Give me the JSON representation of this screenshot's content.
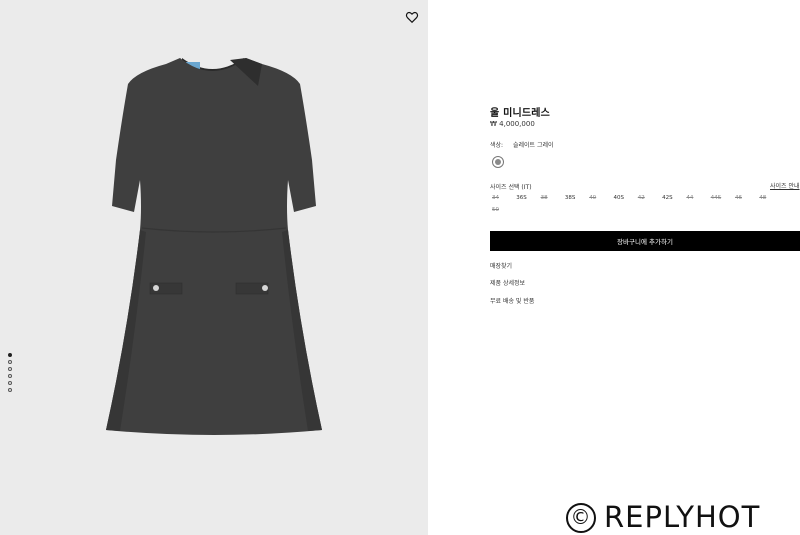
{
  "product": {
    "title": "울 미니드레스",
    "price": "₩ 4,000,000",
    "color_label": "색상:",
    "color_value": "슬레이트 그레이",
    "swatch_color": "#8a8a8a",
    "dress_color": "#3f3f3f"
  },
  "sizes": {
    "label": "사이즈 선택 (IT)",
    "guide_link": "사이즈 안내",
    "options": [
      {
        "label": "34",
        "available": false
      },
      {
        "label": "36S",
        "available": true
      },
      {
        "label": "38",
        "available": false
      },
      {
        "label": "38S",
        "available": true
      },
      {
        "label": "40",
        "available": false
      },
      {
        "label": "40S",
        "available": true
      },
      {
        "label": "42",
        "available": false
      },
      {
        "label": "42S",
        "available": true
      },
      {
        "label": "44",
        "available": false
      },
      {
        "label": "44S",
        "available": false
      },
      {
        "label": "46",
        "available": false
      },
      {
        "label": "48",
        "available": false
      },
      {
        "label": "50",
        "available": false
      }
    ]
  },
  "actions": {
    "add_to_cart": "장바구니에 추가하기"
  },
  "links": {
    "store_finder": "매장찾기",
    "product_details": "제품 상세정보",
    "shipping_returns": "무료 배송 및 반품"
  },
  "gallery": {
    "image_count": 6,
    "active_index": 0
  },
  "icons": {
    "wishlist": "heart-icon"
  },
  "watermark": {
    "symbol": "©",
    "text": "REPLYHOT"
  }
}
